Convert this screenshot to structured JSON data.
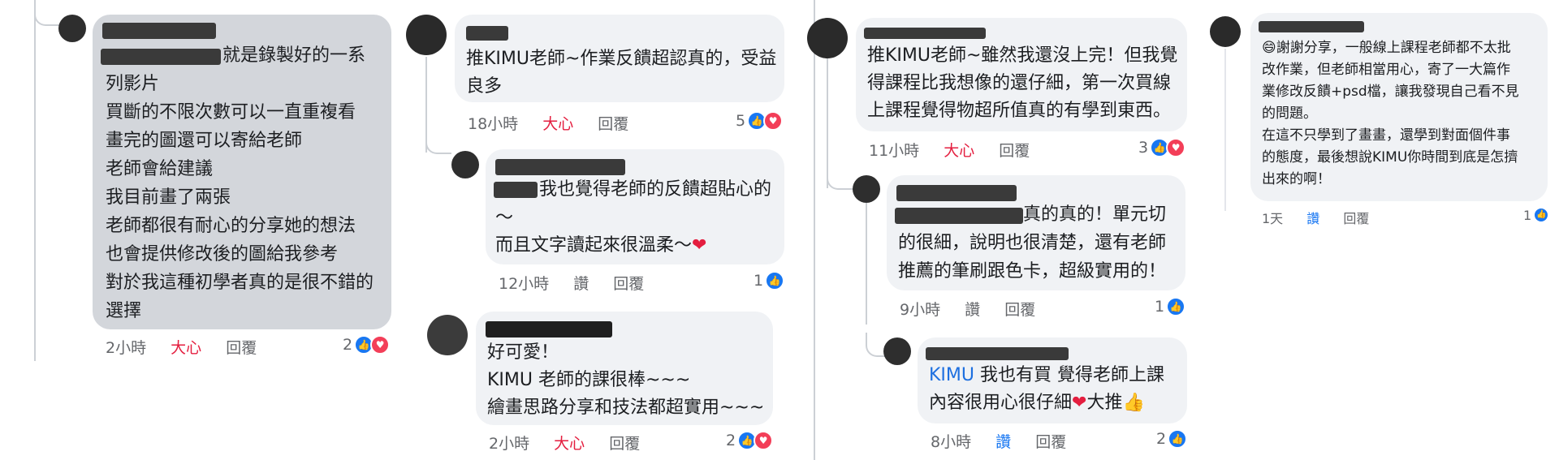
{
  "col1": {
    "comment": {
      "lines": [
        "就是錄製好的一系",
        "列影片",
        "買斷的不限次數可以一直重複看",
        "畫完的圖還可以寄給老師",
        "老師會給建議",
        "我目前畫了兩張",
        "老師都很有耐心的分享她的想法",
        "也會提供修改後的圖給我參考",
        "對於我這種初學者真的是很不錯的",
        "選擇"
      ],
      "time": "2小時",
      "reaction": "大心",
      "reply": "回覆",
      "count": "2"
    }
  },
  "col2": {
    "c1": {
      "line1": "推KIMU老師~作業反饋超認真的，受益",
      "line2": "良多",
      "time": "18小時",
      "reaction": "大心",
      "reply": "回覆",
      "count": "5"
    },
    "c2": {
      "line1": "我也覺得老師的反饋超貼心的",
      "line2": "～",
      "line3": "而且文字讀起來很溫柔～",
      "time": "12小時",
      "reaction": "讚",
      "reply": "回覆",
      "count": "1"
    },
    "c3": {
      "line1": "好可愛！",
      "line2": "KIMU 老師的課很棒~~~",
      "line3": "繪畫思路分享和技法都超實用~~~",
      "time": "2小時",
      "reaction": "大心",
      "reply": "回覆",
      "count": "2"
    }
  },
  "col3": {
    "c1": {
      "line1": "推KIMU老師~雖然我還沒上完！但我覺",
      "line2": "得課程比我想像的還仔細，第一次買線",
      "line3": "上課程覺得物超所值真的有學到東西。",
      "time": "11小時",
      "reaction": "大心",
      "reply": "回覆",
      "count": "3"
    },
    "c2": {
      "line1": "真的真的！單元切",
      "line2": "的很細，說明也很清楚，還有老師",
      "line3": "推薦的筆刷跟色卡，超級實用的！",
      "time": "9小時",
      "reaction": "讚",
      "reply": "回覆",
      "count": "1"
    },
    "c3": {
      "link": "KIMU",
      "line1": " 我也有買 覺得老師上課",
      "line2": "內容很用心很仔細",
      "line2b": "大推",
      "time": "8小時",
      "reaction": "讚",
      "reply": "回覆",
      "count": "2"
    }
  },
  "col4": {
    "c1": {
      "lines": [
        "謝謝分享，一般線上課程老師都不太批",
        "改作業，但老師相當用心，寄了一大篇作",
        "業修改反饋+psd檔，讓我發現自己看不見",
        "的問題。",
        "在這不只學到了畫畫，還學到對面個件事",
        "的態度，最後想說KIMU你時間到底是怎擠",
        "出來的啊！"
      ],
      "time": "1天",
      "reaction": "讚",
      "reply": "回覆",
      "count": "1"
    }
  },
  "icons": {
    "like": "thumbs-up-icon",
    "love": "heart-icon",
    "heart_emoji": "red-heart-emoji",
    "thumb_emoji": "thumbs-up-emoji",
    "smile_emoji": "grinning-face-emoji"
  },
  "colors": {
    "bubble": "#f0f2f5",
    "highlight_bubble": "#d3d6db",
    "love": "#e41e3f",
    "like": "#1877f2"
  }
}
